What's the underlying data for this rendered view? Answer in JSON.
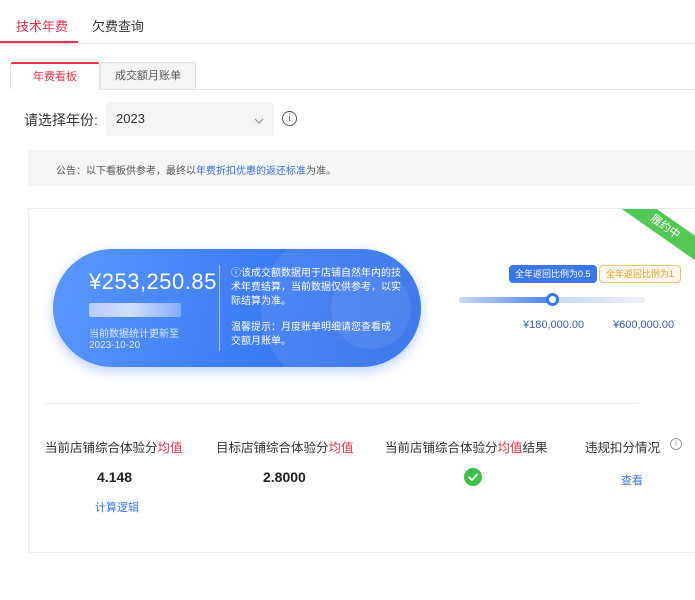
{
  "top_tabs": [
    {
      "label": "技术年费"
    },
    {
      "label": "欠费查询"
    }
  ],
  "sub_tabs": [
    {
      "label": "年费看板"
    },
    {
      "label": "成交额月账单"
    }
  ],
  "year_selector": {
    "label": "请选择年份:",
    "value": "2023",
    "info_icon": "info-circle-icon"
  },
  "notice": {
    "prefix": "公告：以下看板供参考，最终以",
    "highlight": "年费折扣优惠的返还标准",
    "suffix": "为准。"
  },
  "summary": {
    "amount": "¥253,250.85",
    "update_label": "当前数据统计更新至",
    "update_date": "2023-10-20",
    "note": "ⓘ该成交额数据用于店铺自然年内的技术年费结算，当前数据仅供参考，以实际结算为准。",
    "tip": "温馨提示：月度账单明细请您查看成交额月账单。"
  },
  "progress": {
    "badge_1": "全年返回比例为0.5",
    "badge_2": "全年返回比例为1",
    "threshold_1": "¥180,000.00",
    "threshold_2": "¥600,000.00",
    "fill_fraction": 0.5
  },
  "ribbon_label": "履约中",
  "metrics": [
    {
      "title_prefix": "当前店铺综合体验分",
      "title_highlight": "均值",
      "title_suffix": "",
      "value": "4.148",
      "link": "计算逻辑"
    },
    {
      "title_prefix": "目标店铺综合体验分",
      "title_highlight": "均值",
      "title_suffix": "",
      "value": "2.8000"
    },
    {
      "title_prefix": "当前店铺综合体验分",
      "title_highlight": "均值",
      "title_suffix": "结果",
      "value_icon": "check-circle-icon"
    },
    {
      "title_prefix": "违规扣分情况",
      "title_highlight": "",
      "title_suffix": "",
      "link": "查看"
    }
  ],
  "colors": {
    "accent_red": "#e8344a",
    "primary_blue": "#3b76ea",
    "success_green": "#3fbf4a"
  }
}
